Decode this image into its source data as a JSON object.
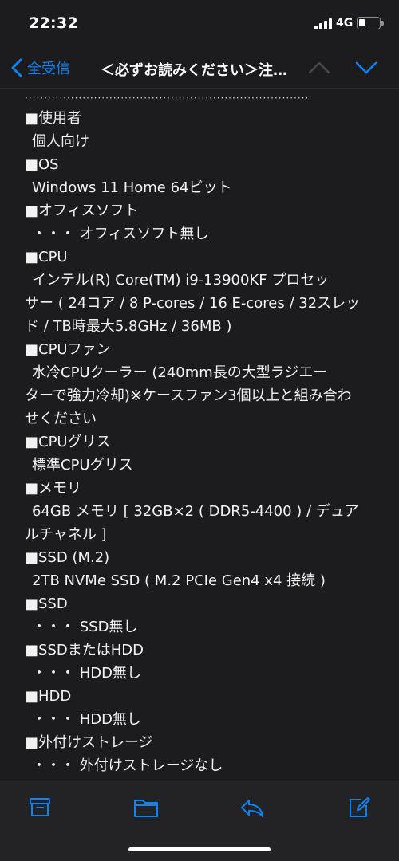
{
  "status_bar": {
    "time": "22:32",
    "network": "4G"
  },
  "nav": {
    "back_label": "全受信",
    "title": "＜必ずお読みください＞注…"
  },
  "content": {
    "separator": "··········································································",
    "lines": [
      {
        "text": "■使用者",
        "kind": "heading"
      },
      {
        "text": "個人向け",
        "kind": "value"
      },
      {
        "text": "■OS",
        "kind": "heading"
      },
      {
        "text": "Windows 11 Home 64ビット",
        "kind": "value"
      },
      {
        "text": "■オフィスソフト",
        "kind": "heading"
      },
      {
        "text": "・・・ オフィスソフト無し",
        "kind": "value"
      },
      {
        "text": "■CPU",
        "kind": "heading"
      },
      {
        "text": "インテル(R) Core(TM) i9-13900KF プロセッ",
        "kind": "value"
      },
      {
        "text": "サー ( 24コア / 8 P-cores / 16 E-cores / 32スレッ",
        "kind": "cont"
      },
      {
        "text": "ド / TB時最大5.8GHz / 36MB )",
        "kind": "cont"
      },
      {
        "text": "■CPUファン",
        "kind": "heading"
      },
      {
        "text": "水冷CPUクーラー (240mm長の大型ラジエー",
        "kind": "value"
      },
      {
        "text": "ターで強力冷却)※ケースファン3個以上と組み合わ",
        "kind": "cont"
      },
      {
        "text": "せください",
        "kind": "cont"
      },
      {
        "text": "■CPUグリス",
        "kind": "heading"
      },
      {
        "text": "標準CPUグリス",
        "kind": "value"
      },
      {
        "text": "■メモリ",
        "kind": "heading"
      },
      {
        "text": "64GB メモリ [ 32GB×2 ( DDR5-4400 ) / デュア",
        "kind": "value"
      },
      {
        "text": "ルチャネル ]",
        "kind": "cont"
      },
      {
        "text": "■SSD (M.2)",
        "kind": "heading"
      },
      {
        "text": "2TB NVMe SSD ( M.2 PCIe Gen4 x4 接続 )",
        "kind": "value"
      },
      {
        "text": "■SSD",
        "kind": "heading"
      },
      {
        "text": "・・・ SSD無し",
        "kind": "value"
      },
      {
        "text": "■SSDまたはHDD",
        "kind": "heading"
      },
      {
        "text": "・・・ HDD無し",
        "kind": "value"
      },
      {
        "text": "■HDD",
        "kind": "heading"
      },
      {
        "text": "・・・ HDD無し",
        "kind": "value"
      },
      {
        "text": "■外付けストレージ",
        "kind": "heading"
      },
      {
        "text": "・・・ 外付けストレージなし",
        "kind": "value"
      }
    ]
  },
  "toolbar": {
    "icons": [
      "archive-icon",
      "folder-icon",
      "reply-icon",
      "compose-icon"
    ]
  },
  "colors": {
    "accent": "#0a84ff",
    "background": "#1c1c1e",
    "toolbar": "#232325"
  }
}
